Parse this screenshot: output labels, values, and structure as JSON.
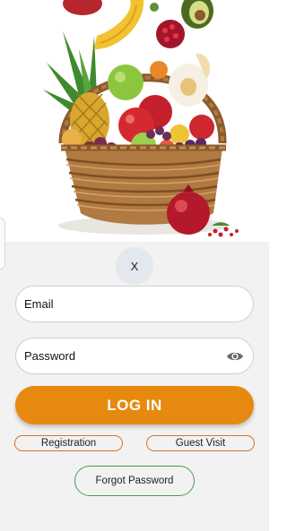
{
  "hero": {
    "image_icon": "fruit-basket-illustration"
  },
  "close_button": {
    "label": "X"
  },
  "email": {
    "placeholder": "Email",
    "value": ""
  },
  "password": {
    "placeholder": "Password",
    "value": "",
    "toggle_icon": "eye-icon"
  },
  "login": {
    "label": "LOG IN"
  },
  "registration": {
    "label": "Registration"
  },
  "guest": {
    "label": "Guest Visit"
  },
  "forgot": {
    "label": "Forgot Password"
  },
  "colors": {
    "primary": "#e8890f",
    "registration_border": "#d9742a",
    "forgot_border": "#4a9a55",
    "panel_background": "#f2f2f2",
    "close_background": "#e2e8ee"
  }
}
